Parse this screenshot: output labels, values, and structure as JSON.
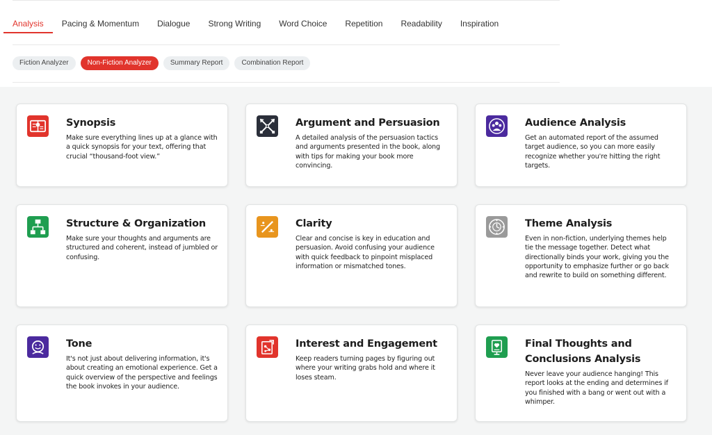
{
  "tabs": [
    {
      "label": "Analysis",
      "active": true
    },
    {
      "label": "Pacing & Momentum"
    },
    {
      "label": "Dialogue"
    },
    {
      "label": "Strong Writing"
    },
    {
      "label": "Word Choice"
    },
    {
      "label": "Repetition"
    },
    {
      "label": "Readability"
    },
    {
      "label": "Inspiration"
    }
  ],
  "pills": [
    {
      "label": "Fiction Analyzer"
    },
    {
      "label": "Non-Fiction Analyzer",
      "active": true
    },
    {
      "label": "Summary Report"
    },
    {
      "label": "Combination Report"
    }
  ],
  "colors": {
    "accent": "#e1342c",
    "dark": "#2b2f3a",
    "purple": "#4b2a9e",
    "green": "#1f9e50",
    "orange": "#e8951e",
    "gray": "#9a9a9a"
  },
  "cards": [
    {
      "title": "Synopsis",
      "icon": "book-icon",
      "desc": "Make sure everything lines up at a glance with a quick synopsis for your text, offering that crucial “thousand-foot view.”"
    },
    {
      "title": "Argument and Persuasion",
      "icon": "crossed-swords-icon",
      "desc": "A detailed analysis of the persuasion tactics and arguments presented in the book, along with tips for making your book more convincing."
    },
    {
      "title": "Audience Analysis",
      "icon": "audience-icon",
      "desc": "Get an automated report of the assumed target audience, so you can more easily recognize whether you're hitting the right targets."
    },
    {
      "title": "Structure & Organization",
      "icon": "structure-icon",
      "desc": "Make sure your thoughts and arguments are structured and coherent, instead of jumbled or confusing."
    },
    {
      "title": "Clarity",
      "icon": "clarity-icon",
      "desc": "Clear and concise is key in education and persuasion. Avoid confusing your audience with quick feedback to pinpoint misplaced information or mismatched tones."
    },
    {
      "title": "Theme Analysis",
      "icon": "theme-icon",
      "desc": "Even in non-fiction, underlying themes help tie the message together. Detect what directionally binds your work, giving you the opportunity to emphasize further or go back and rewrite to build on something different."
    },
    {
      "title": "Tone",
      "icon": "tone-icon",
      "desc": "It's not just about delivering information, it's about creating an emotional experience. Get a quick overview of the perspective and feelings the book invokes in your audience."
    },
    {
      "title": "Interest and Engagement",
      "icon": "engagement-icon",
      "desc": "Keep readers turning pages by figuring out where your writing grabs hold and where it loses steam."
    },
    {
      "title": "Final Thoughts and Conclusions Analysis",
      "icon": "conclusion-icon",
      "desc": "Never leave your audience hanging! This report looks at the ending and determines if you finished with a bang or went out with a whimper."
    }
  ]
}
